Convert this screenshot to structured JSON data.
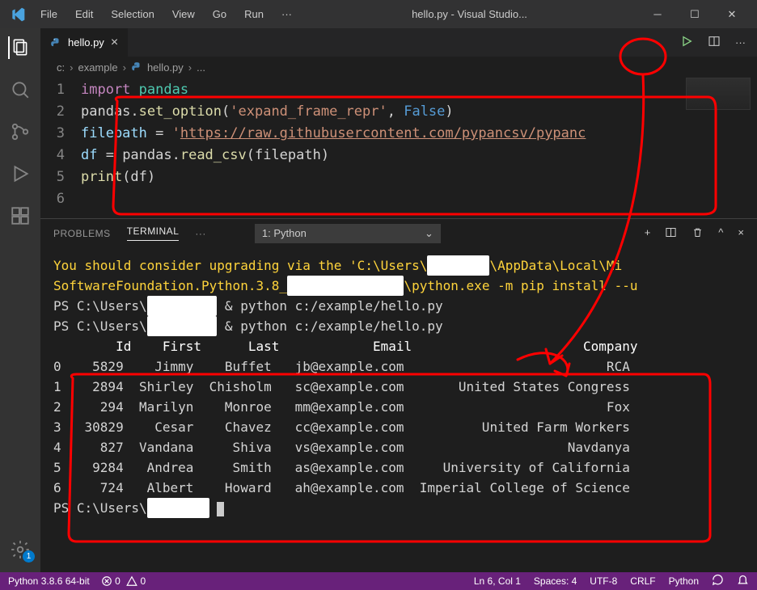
{
  "menu": {
    "file": "File",
    "edit": "Edit",
    "selection": "Selection",
    "view": "View",
    "go": "Go",
    "run": "Run",
    "more": "···"
  },
  "window": {
    "title": "hello.py - Visual Studio..."
  },
  "tab": {
    "name": "hello.py"
  },
  "breadcrumb": {
    "c": "c:",
    "folder": "example",
    "file": "hello.py",
    "more": "..."
  },
  "code": {
    "l1": {
      "kw": "import",
      "mod": " pandas"
    },
    "l2": {
      "a": "pandas.",
      "fn": "set_option",
      "p1": "(",
      "s": "'expand_frame_repr'",
      "c": ", ",
      "lit": "False",
      "p2": ")"
    },
    "l3": {
      "v": "filepath ",
      "eq": "= ",
      "s1": "'",
      "url": "https://raw.githubusercontent.com/pypancsv/pypanc"
    },
    "l4": {
      "v": "df ",
      "eq": "= pandas.",
      "fn": "read_csv",
      "p1": "(filepath)",
      "rest": ""
    },
    "l5": {
      "fn": "print",
      "p": "(df)"
    }
  },
  "panel": {
    "problems": "PROBLEMS",
    "terminal": "TERMINAL",
    "more": "···",
    "select": "1: Python"
  },
  "term": {
    "warn1": "You should consider upgrading via the 'C:\\Users\\",
    "warn1b": "\\AppData\\Local\\Mi",
    "warn2": "SoftwareFoundation.Python.3.8_",
    "warn2b": "\\python.exe -m pip install --u",
    "ps1a": "PS C:\\Users\\",
    "ps1b": " & python c:/example/hello.py",
    "hdr": "        Id    First      Last            Email                      Company",
    "r0": "0    5829    Jimmy    Buffet   jb@example.com                          RCA",
    "r1": "1    2894  Shirley  Chisholm   sc@example.com       United States Congress",
    "r2": "2     294  Marilyn    Monroe   mm@example.com                          Fox",
    "r3": "3   30829    Cesar    Chavez   cc@example.com          United Farm Workers",
    "r4": "4     827  Vandana     Shiva   vs@example.com                     Navdanya",
    "r5": "5    9284   Andrea     Smith   as@example.com     University of California",
    "r6": "6     724   Albert    Howard   ah@example.com  Imperial College of Science",
    "psend": "PS C:\\Users\\"
  },
  "status": {
    "python": "Python 3.8.6 64-bit",
    "errors": "0",
    "warnings": "0",
    "pos": "Ln 6, Col 1",
    "spaces": "Spaces: 4",
    "enc": "UTF-8",
    "eol": "CRLF",
    "lang": "Python"
  },
  "badge": "1"
}
